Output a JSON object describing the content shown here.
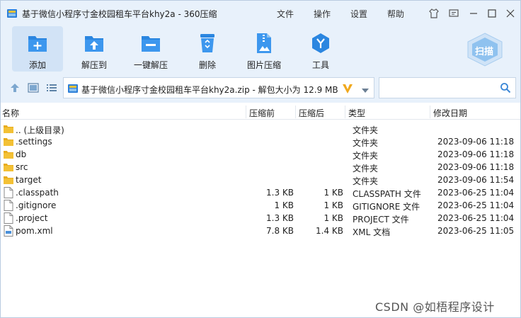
{
  "window": {
    "title": "基于微信小程序寸金校园租车平台khy2a - 360压缩",
    "menu": [
      "文件",
      "操作",
      "设置",
      "帮助"
    ]
  },
  "toolbar": {
    "items": [
      {
        "label": "添加",
        "icon": "add-icon"
      },
      {
        "label": "解压到",
        "icon": "extract-to-icon"
      },
      {
        "label": "一键解压",
        "icon": "one-click-extract-icon"
      },
      {
        "label": "删除",
        "icon": "trash-icon"
      },
      {
        "label": "图片压缩",
        "icon": "image-compress-icon"
      },
      {
        "label": "工具",
        "icon": "tools-icon"
      }
    ],
    "scan_label": "扫描"
  },
  "addressbar": {
    "path": "基于微信小程序寸金校园租车平台khy2a.zip - 解包大小为 12.9 MB",
    "search_value": ""
  },
  "columns": {
    "name": "名称",
    "size_before": "压缩前",
    "size_after": "压缩后",
    "type": "类型",
    "date": "修改日期"
  },
  "files": [
    {
      "name": ".. (上级目录)",
      "size_before": "",
      "size_after": "",
      "type": "文件夹",
      "date": "",
      "kind": "folder"
    },
    {
      "name": ".settings",
      "size_before": "",
      "size_after": "",
      "type": "文件夹",
      "date": "2023-09-06 11:18",
      "kind": "folder"
    },
    {
      "name": "db",
      "size_before": "",
      "size_after": "",
      "type": "文件夹",
      "date": "2023-09-06 11:18",
      "kind": "folder"
    },
    {
      "name": "src",
      "size_before": "",
      "size_after": "",
      "type": "文件夹",
      "date": "2023-09-06 11:18",
      "kind": "folder"
    },
    {
      "name": "target",
      "size_before": "",
      "size_after": "",
      "type": "文件夹",
      "date": "2023-09-06 11:54",
      "kind": "folder"
    },
    {
      "name": ".classpath",
      "size_before": "1.3 KB",
      "size_after": "1 KB",
      "type": "CLASSPATH 文件",
      "date": "2023-06-25 11:04",
      "kind": "file"
    },
    {
      "name": ".gitignore",
      "size_before": "1 KB",
      "size_after": "1 KB",
      "type": "GITIGNORE 文件",
      "date": "2023-06-25 11:04",
      "kind": "file"
    },
    {
      "name": ".project",
      "size_before": "1.3 KB",
      "size_after": "1 KB",
      "type": "PROJECT 文件",
      "date": "2023-06-25 11:04",
      "kind": "file"
    },
    {
      "name": "pom.xml",
      "size_before": "7.8 KB",
      "size_after": "1.4 KB",
      "type": "XML 文档",
      "date": "2023-06-25 11:05",
      "kind": "xml"
    }
  ],
  "watermark": "CSDN @如梧程序设计",
  "colors": {
    "accent": "#1e88e5",
    "toolbar_bg": "#e8f1fb",
    "folder": "#f3c136"
  }
}
